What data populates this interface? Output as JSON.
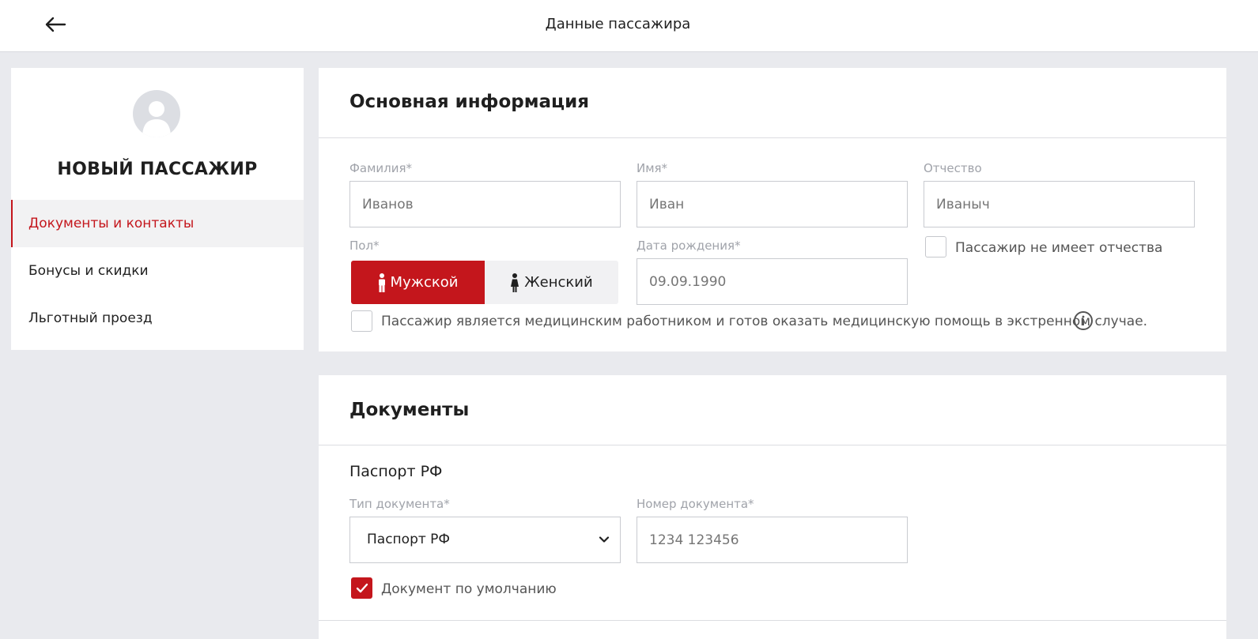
{
  "header": {
    "title": "Данные пассажира"
  },
  "sidebar": {
    "passenger_name": "НОВЫЙ ПАССАЖИР",
    "items": [
      {
        "label": "Документы и контакты",
        "active": true
      },
      {
        "label": "Бонусы и скидки",
        "active": false
      },
      {
        "label": "Льготный проезд",
        "active": false
      }
    ]
  },
  "basic_info": {
    "title": "Основная информация",
    "last_name": {
      "label": "Фамилия*",
      "placeholder": "Иванов"
    },
    "first_name": {
      "label": "Имя*",
      "placeholder": "Иван"
    },
    "patronymic": {
      "label": "Отчество",
      "placeholder": "Иваныч"
    },
    "no_patronymic_label": "Пассажир не имеет отчества",
    "gender": {
      "label": "Пол*",
      "male": "Мужской",
      "female": "Женский",
      "selected": "male"
    },
    "birth_date": {
      "label": "Дата рождения*",
      "placeholder": "09.09.1990"
    },
    "medical_worker_label": "Пассажир является медицинским работником и готов оказать медицинскую помощь в экстренном случае."
  },
  "documents": {
    "title": "Документы",
    "subtitle": "Паспорт РФ",
    "doc_type": {
      "label": "Тип документа*",
      "value": "Паспорт РФ"
    },
    "doc_number": {
      "label": "Номер документа*",
      "placeholder": "1234 123456"
    },
    "default_doc_label": "Документ по умолчанию",
    "default_doc_checked": true
  },
  "colors": {
    "accent": "#c4161c",
    "background": "#e9eaee"
  },
  "icons": [
    "back-arrow-icon",
    "avatar-placeholder-icon",
    "male-icon",
    "female-icon",
    "info-icon",
    "chevron-down-icon",
    "checkmark-icon"
  ]
}
